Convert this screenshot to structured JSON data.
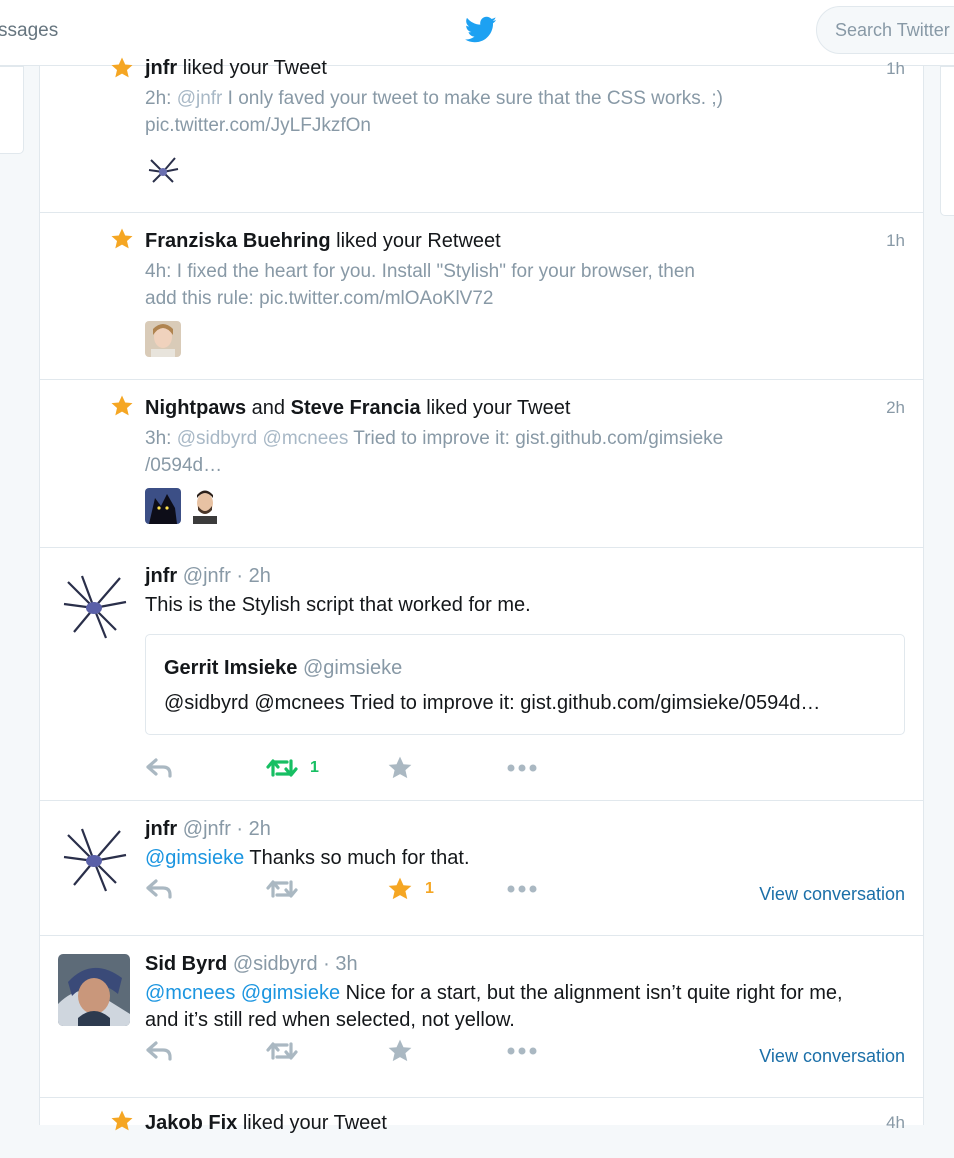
{
  "header": {
    "nav_messages_label": "ssages",
    "search_placeholder": "Search Twitter"
  },
  "colors": {
    "accent": "#1da1f2",
    "like": "#f5a623",
    "retweet": "#17bf63",
    "border": "#e1e8ed",
    "muted": "#8899a6"
  },
  "notifications": [
    {
      "type": "like",
      "names": [
        "jnfr"
      ],
      "joiner": "",
      "action": " liked your Tweet",
      "time": "1h",
      "preview_time": "2h:",
      "preview_mention": "@jnfr",
      "preview_text": " I only faved your tweet to make sure that the CSS works. ;)",
      "preview_line2": "pic.twitter.com/JyLFJkzfOn"
    },
    {
      "type": "like",
      "names": [
        "Franziska Buehring"
      ],
      "joiner": "",
      "action": " liked your Retweet",
      "time": "1h",
      "preview_line1": "4h: I fixed the heart for you. Install \"Stylish\" for your browser, then",
      "preview_line2": "add this rule: pic.twitter.com/mlOAoKlV72"
    },
    {
      "type": "like",
      "names": [
        "Nightpaws",
        "Steve Francia"
      ],
      "joiner": " and ",
      "action": " liked your Tweet",
      "time": "2h",
      "preview_time": "3h:",
      "preview_mention1": "@sidbyrd",
      "preview_mention2": "@mcnees",
      "preview_text": " Tried to improve it: gist.github.com/gimsieke",
      "preview_line2": "/0594d…"
    },
    {
      "type": "like",
      "names": [
        "Jakob Fix"
      ],
      "action": " liked your Tweet",
      "time": "4h"
    }
  ],
  "tweets": [
    {
      "name": "jnfr",
      "handle": "@jnfr",
      "sep": " · ",
      "time": "2h",
      "text": "This is the Stylish script that worked for me.",
      "quote": {
        "name": "Gerrit Imsieke",
        "handle": "@gimsieke",
        "text": "@sidbyrd @mcnees Tried to improve it: gist.github.com/gimsieke/0594d…"
      },
      "retweet_count": "1",
      "like_count": ""
    },
    {
      "name": "jnfr",
      "handle": "@jnfr",
      "sep": " · ",
      "time": "2h",
      "mention": "@gimsieke",
      "text": " Thanks so much for that.",
      "like_count": "1",
      "view_conversation": "View conversation"
    },
    {
      "name": "Sid Byrd",
      "handle": "@sidbyrd",
      "sep": " · ",
      "time": "3h",
      "mention1": "@mcnees",
      "mention2": "@gimsieke",
      "text_line1": " Nice for a start, but the alignment isn’t quite right for me,",
      "text_line2": "and it’s still red when selected, not yellow.",
      "view_conversation": "View conversation"
    }
  ]
}
